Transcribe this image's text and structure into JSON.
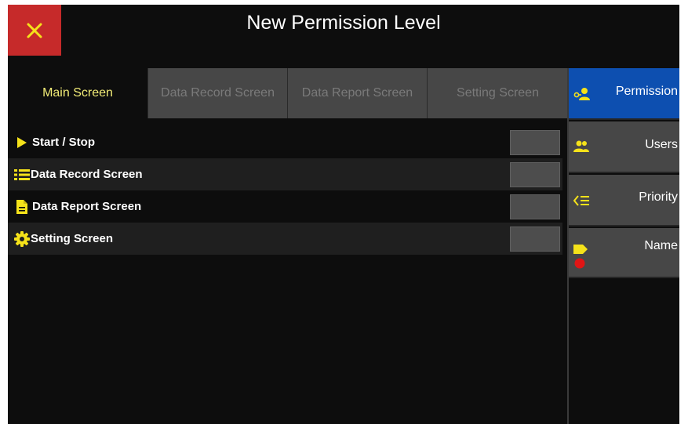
{
  "header": {
    "title": "New Permission Level",
    "close_icon": "close-icon",
    "close_color": "#c62a2a"
  },
  "tabs": [
    {
      "label": "Main Screen",
      "active": true
    },
    {
      "label": "Data Record Screen",
      "active": false
    },
    {
      "label": "Data Report Screen",
      "active": false
    },
    {
      "label": "Setting Screen",
      "active": false
    }
  ],
  "rows": [
    {
      "label": "Start / Stop",
      "icon": "play-icon"
    },
    {
      "label": "Data Record Screen",
      "icon": "list-icon"
    },
    {
      "label": "Data Report Screen",
      "icon": "document-icon"
    },
    {
      "label": "Setting Screen",
      "icon": "gear-icon"
    }
  ],
  "sidebar": {
    "items": [
      {
        "label": "Permission",
        "icon": "key-user-icon",
        "active": true
      },
      {
        "label": "Users",
        "icon": "users-icon",
        "active": false
      },
      {
        "label": "Priority",
        "icon": "priority-icon",
        "active": false
      },
      {
        "label": "Name",
        "icon": "tag-icon",
        "active": false
      }
    ]
  },
  "colors": {
    "accent_yellow": "#f5e21a",
    "active_tab_text": "#f2ec77",
    "sidebar_active": "#0d4fb0",
    "alert_red": "#e01515"
  }
}
